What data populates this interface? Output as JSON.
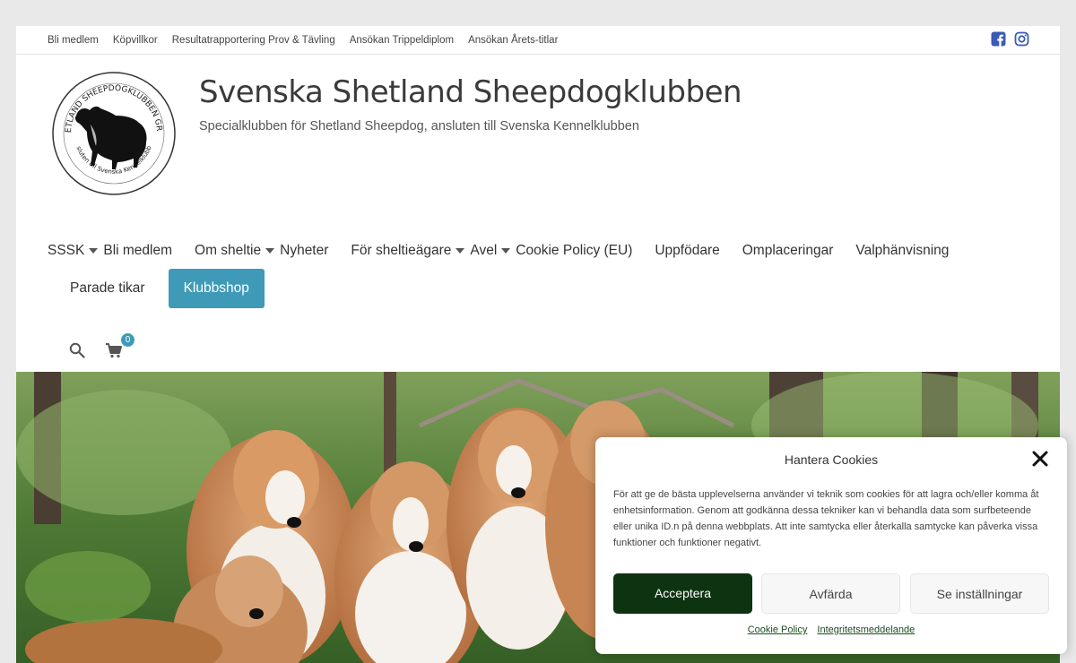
{
  "topbar": {
    "links": [
      "Bli medlem",
      "Köpvillkor",
      "Resultatrapportering Prov & Tävling",
      "Ansökan Trippeldiplom",
      "Ansökan Årets-titlar"
    ],
    "social": [
      "facebook-icon",
      "instagram-icon"
    ]
  },
  "header": {
    "title": "Svenska Shetland Sheepdogklubben",
    "tagline": "Specialklubben för Shetland Sheepdog, ansluten till Svenska Kennelklubben",
    "logo_text_top": "SVENSKA SHETLAND SHEEPDOGKLUBBEN GRUNDAD 1967",
    "logo_text_bottom": "Ansluten till Svenska Kennelklubben"
  },
  "nav": {
    "items": [
      {
        "label": "SSSK",
        "caret": true
      },
      {
        "label": "Bli medlem",
        "caret": false
      },
      {
        "label": "Om sheltie",
        "caret": true
      },
      {
        "label": "Nyheter",
        "caret": false
      },
      {
        "label": "För sheltieägare",
        "caret": true
      },
      {
        "label": "Avel",
        "caret": true
      },
      {
        "label": "Cookie Policy (EU)",
        "caret": false
      },
      {
        "label": "Uppfödare",
        "caret": false
      },
      {
        "label": "Omplaceringar",
        "caret": false
      },
      {
        "label": "Valphänvisning",
        "caret": false
      }
    ],
    "row2": {
      "parade": "Parade tikar",
      "shop": "Klubbshop"
    },
    "cart_count": "0"
  },
  "cookie": {
    "title": "Hantera Cookies",
    "text": "För att ge de bästa upplevelserna använder vi teknik som cookies för att lagra och/eller komma åt enhetsinformation. Genom att godkänna dessa tekniker kan vi behandla data som surfbeteende eller unika ID.n på denna webbplats. Att inte samtycka eller återkalla samtycke kan påverka vissa funktioner och funktioner negativt.",
    "accept": "Acceptera",
    "deny": "Avfärda",
    "prefs": "Se inställningar",
    "link_policy": "Cookie Policy",
    "link_privacy": "Integritetsmeddelande"
  },
  "colors": {
    "accent": "#3f9ab8",
    "accept_bg": "#0e3311"
  }
}
